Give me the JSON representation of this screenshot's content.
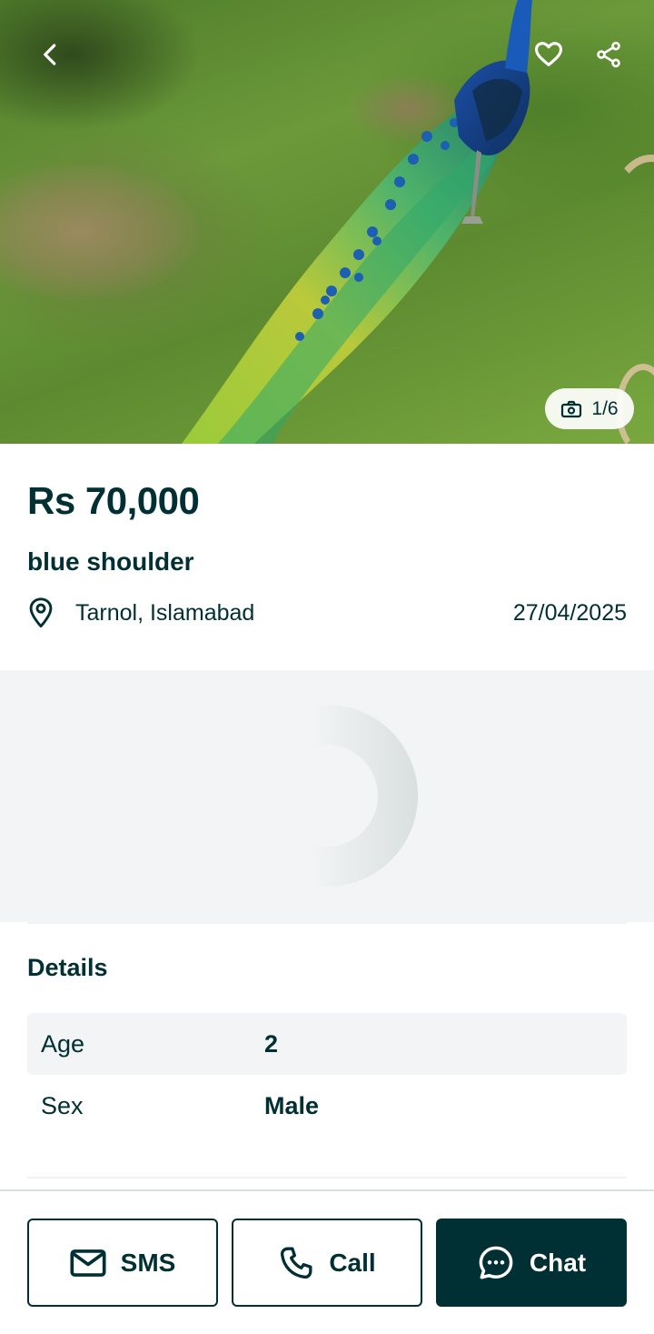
{
  "gallery": {
    "counter": "1/6",
    "icons": {
      "back": "chevron-left-icon",
      "favorite": "heart-icon",
      "share": "share-icon",
      "camera": "camera-icon"
    }
  },
  "listing": {
    "price": "Rs 70,000",
    "title": "blue shoulder",
    "location": "Tarnol, Islamabad",
    "date": "27/04/2025"
  },
  "details": {
    "heading": "Details",
    "rows": [
      {
        "key": "Age",
        "value": "2"
      },
      {
        "key": "Sex",
        "value": "Male"
      }
    ]
  },
  "actions": {
    "sms_label": "SMS",
    "call_label": "Call",
    "chat_label": "Chat"
  },
  "colors": {
    "primary": "#002f34",
    "surface": "#f2f4f5",
    "white": "#ffffff"
  }
}
